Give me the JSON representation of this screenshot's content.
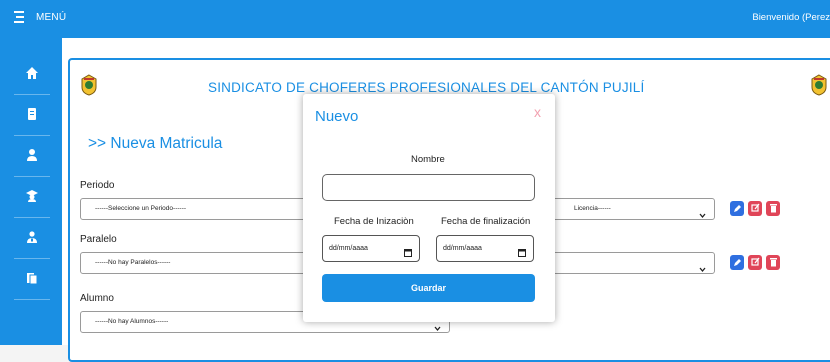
{
  "header": {
    "menu_label": "MENÚ",
    "welcome_text": "Bienvenido (Perez",
    "accent_color": "#1a8fe3"
  },
  "sidebar": {
    "items": [
      {
        "icon": "home-icon"
      },
      {
        "icon": "document-icon"
      },
      {
        "icon": "user-icon"
      },
      {
        "icon": "graduate-icon"
      },
      {
        "icon": "users-icon"
      },
      {
        "icon": "files-icon"
      }
    ]
  },
  "main": {
    "org_title": "SINDICATO DE CHOFERES PROFESIONALES DEL CANTÓN PUJILÍ",
    "page_heading": ">> Nueva Matricula",
    "fields": {
      "periodo_label": "Periodo",
      "periodo_value": "------Seleccione un Periodo------",
      "licencia_value": "Licencia------",
      "paralelo_label": "Paralelo",
      "paralelo_value": "------No hay Paralelos------",
      "alumno_label": "Alumno",
      "alumno_value": "------No hay Alumnos------"
    }
  },
  "modal": {
    "title": "Nuevo",
    "close": "x",
    "name_label": "Nombre",
    "name_value": "",
    "start_label": "Fecha de Inizaciòn",
    "end_label": "Fecha de finalización",
    "start_value": "dd/mm/aaaa",
    "end_value": "dd/mm/aaaa",
    "save_label": "Guardar"
  }
}
